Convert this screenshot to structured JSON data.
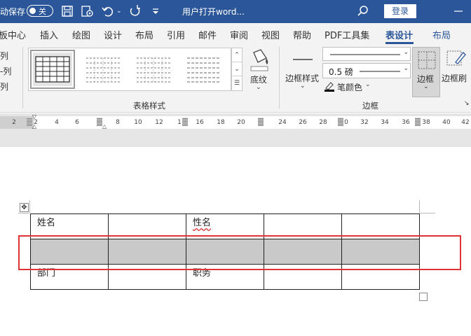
{
  "titlebar": {
    "autosave_label": "动保存",
    "autosave_state": "关",
    "doc_title": "用户打开word...",
    "login_label": "登录",
    "icons": [
      "save-icon",
      "page-settings-icon",
      "undo-icon",
      "redo-icon",
      "customize-toolbar-icon",
      "search-icon"
    ]
  },
  "tabs": [
    {
      "label": "板中心"
    },
    {
      "label": "插入"
    },
    {
      "label": "绘图"
    },
    {
      "label": "设计"
    },
    {
      "label": "布局"
    },
    {
      "label": "引用"
    },
    {
      "label": "邮件"
    },
    {
      "label": "审阅"
    },
    {
      "label": "视图"
    },
    {
      "label": "帮助"
    },
    {
      "label": "PDF工具集"
    },
    {
      "label": "表设计",
      "active": true
    },
    {
      "label": "布局"
    }
  ],
  "ribbon": {
    "left_labels": [
      "列",
      "-列",
      "列"
    ],
    "table_styles_group": "表格样式",
    "shading_label": "底纹",
    "border_styles_label": "边框样式",
    "line_weight": "0.5 磅",
    "pen_color_label": "笔颜色",
    "borders_group": "边框",
    "borders_btn": "边框",
    "border_painter": "边框刷",
    "pen_color": "#000000"
  },
  "ruler": {
    "ticks": [
      "2",
      "2",
      "4",
      "6",
      "8",
      "10",
      "12",
      "1",
      "16",
      "18",
      "20",
      "24",
      "26",
      "28",
      "0",
      "32",
      "34",
      "36",
      "38",
      "40",
      "42"
    ]
  },
  "table": {
    "rows": [
      [
        "姓名",
        "",
        "性名",
        "",
        ""
      ],
      [
        "",
        "",
        "",
        "",
        ""
      ],
      [
        "部门",
        "",
        "职务",
        "",
        ""
      ]
    ]
  },
  "colors": {
    "brand": "#2b579a",
    "highlight": "#e03434",
    "shading": "#c9c9c9"
  }
}
